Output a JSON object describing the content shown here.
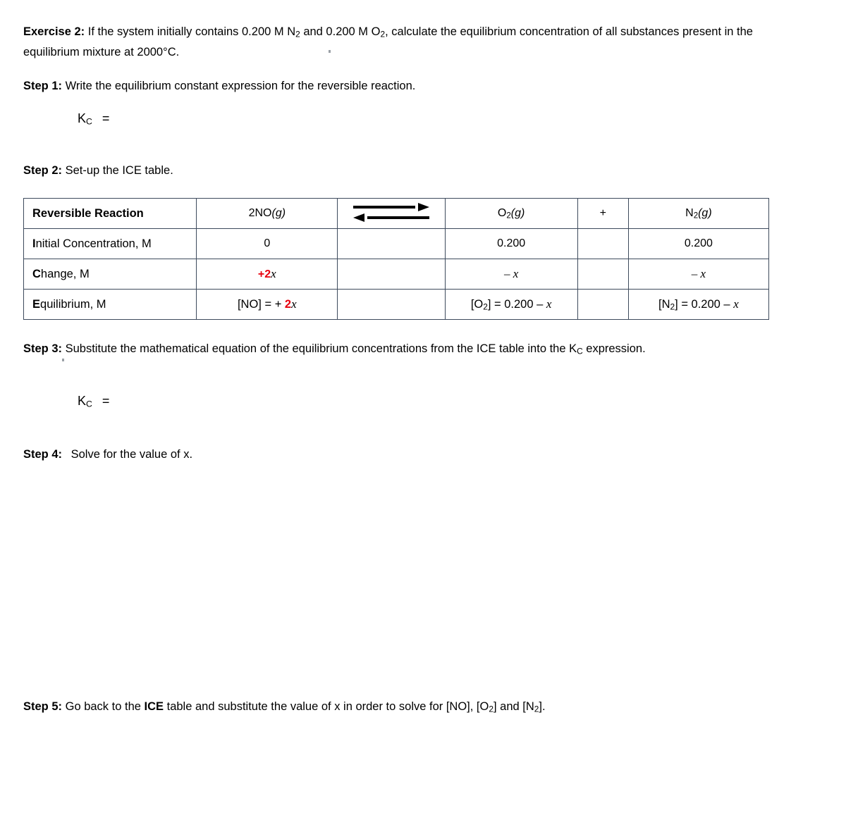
{
  "exercise": {
    "label": "Exercise 2:",
    "text_part1": "If the system initially contains 0.200 M N",
    "n_sub": "2",
    "text_part2": " and 0.200 M O",
    "o_sub": "2",
    "text_part3": ", calculate the equilibrium concentration of all substances present in the equilibrium mixture at 2000°C."
  },
  "steps": {
    "step1": {
      "label": "Step 1:",
      "text": "Write the equilibrium constant expression for the reversible reaction."
    },
    "step2": {
      "label": "Step 2:",
      "text": "Set-up the ICE table."
    },
    "step3": {
      "label": "Step 3:",
      "text_part1": "Substitute the mathematical equation of the equilibrium concentrations from the ICE table into the K",
      "sub": "C",
      "text_part2": " expression."
    },
    "step4": {
      "label": "Step 4:",
      "text": "Solve for the value of x."
    },
    "step5": {
      "label": "Step 5:",
      "text_part1": "Go back to the ",
      "bold_ice": "ICE",
      "text_part2": " table and substitute the value of x in order to solve for [NO], [O",
      "sub_o": "2",
      "text_part3": "] and [N",
      "sub_n": "2",
      "text_part4": "]."
    }
  },
  "kc_expressions": {
    "kc_symbol": "K",
    "kc_subscript": "C",
    "equals": "=",
    "step1_value": "",
    "step3_value": ""
  },
  "ice_table": {
    "header": {
      "row_label": "Reversible Reaction",
      "reactant": "2NO",
      "reactant_state": "(g)",
      "arrow_icon": "equilibrium-double-arrow",
      "product1": "O",
      "product1_sub": "2",
      "product1_state": "(g)",
      "plus": "+",
      "product2": "N",
      "product2_sub": "2",
      "product2_state": "(g)"
    },
    "initial": {
      "row_label_first": "I",
      "row_label_rest": "nitial Concentration, M",
      "no": "0",
      "arrow_cell": "",
      "o2": "0.200",
      "plus_cell": "",
      "n2": "0.200"
    },
    "change": {
      "row_label_first": "C",
      "row_label_rest": "hange, M",
      "no_red": "+2",
      "no_var": "x",
      "arrow_cell": "",
      "o2_minus": "– ",
      "o2_var": "x",
      "plus_cell": "",
      "n2_minus": "– ",
      "n2_var": "x"
    },
    "equilibrium": {
      "row_label_first": "E",
      "row_label_rest": "quilibrium, M",
      "no_prefix": "[NO]  =  + ",
      "no_red": "2",
      "no_var": "x",
      "arrow_cell": "",
      "o2_prefix": "[O",
      "o2_sub": "2",
      "o2_rest": "]  =  0.200 – ",
      "o2_var": "x",
      "plus_cell": "",
      "n2_prefix": "[N",
      "n2_sub": "2",
      "n2_rest": "]  = 0.200 – ",
      "n2_var": "x"
    }
  },
  "colors": {
    "table_border": "#3d4a5c",
    "highlight_red": "#e8000d",
    "text": "#000000"
  }
}
